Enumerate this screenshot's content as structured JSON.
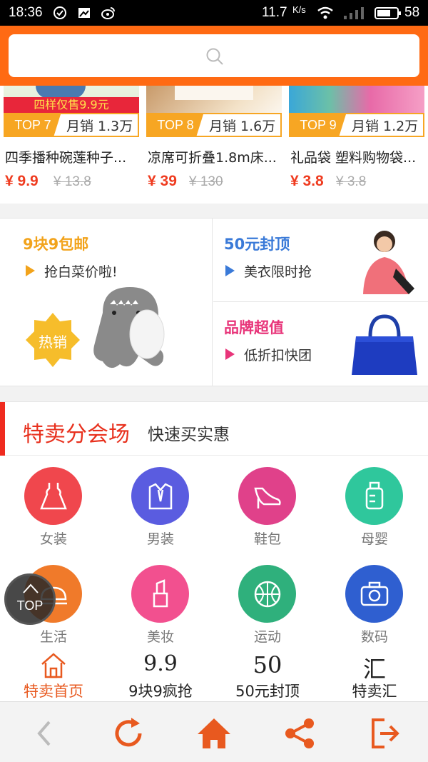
{
  "status_bar": {
    "time": "18:36",
    "speed": "11.7",
    "speed_unit": "K/s",
    "battery": "58"
  },
  "search": {
    "icon": "search-icon"
  },
  "products": [
    {
      "rank": "TOP 7",
      "sales": "月销 1.3万",
      "name": "四季播种碗莲种子...",
      "price": "¥ 9.9",
      "old_price": "¥ 13.8",
      "banner_text": "四样仅售9.9元"
    },
    {
      "rank": "TOP 8",
      "sales": "月销 1.6万",
      "name": "凉席可折叠1.8m床...",
      "price": "¥ 39",
      "old_price": "¥ 130"
    },
    {
      "rank": "TOP 9",
      "sales": "月销 1.2万",
      "name": "礼品袋 塑料购物袋...",
      "price": "¥ 3.8",
      "old_price": "¥ 3.8"
    }
  ],
  "promo": {
    "left": {
      "title": "9块9包邮",
      "sub": "抢白菜价啦!",
      "badge": "热销",
      "color": "#f2a31b"
    },
    "right_top": {
      "title": "50元封顶",
      "sub": "美衣限时抢",
      "color": "#3a7ad8"
    },
    "right_bottom": {
      "title": "品牌超值",
      "sub": "低折扣快团",
      "color": "#e8357a"
    }
  },
  "section": {
    "title": "特卖分会场",
    "subtitle": "快速买实惠"
  },
  "categories": [
    {
      "label": "女装",
      "color": "#f0474d",
      "icon": "dress-icon"
    },
    {
      "label": "男装",
      "color": "#5a5ce0",
      "icon": "suit-icon"
    },
    {
      "label": "鞋包",
      "color": "#e0418a",
      "icon": "heel-icon"
    },
    {
      "label": "母婴",
      "color": "#2fc79c",
      "icon": "bottle-icon"
    },
    {
      "label": "生活",
      "color": "#f07a2a",
      "icon": "dish-icon"
    },
    {
      "label": "美妆",
      "color": "#f2508f",
      "icon": "lipstick-icon"
    },
    {
      "label": "运动",
      "color": "#2fb07c",
      "icon": "ball-icon"
    },
    {
      "label": "数码",
      "color": "#2f5fd0",
      "icon": "camera-icon"
    }
  ],
  "top_button": "TOP",
  "tabs": [
    {
      "label": "特卖首页",
      "glyph": "",
      "active": true
    },
    {
      "label": "9块9疯抢",
      "glyph": "9.9"
    },
    {
      "label": "50元封顶",
      "glyph": "50"
    },
    {
      "label": "特卖汇",
      "glyph": "汇"
    }
  ],
  "colors": {
    "accent": "#ff6a13",
    "price": "#ef3b1f",
    "browser_icon": "#e8591f"
  }
}
